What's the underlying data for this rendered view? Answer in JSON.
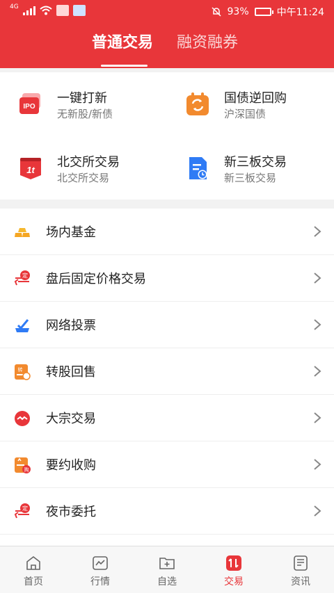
{
  "status_bar": {
    "network": "4G",
    "battery": "93%",
    "time": "中午11:24"
  },
  "tabs": [
    {
      "label": "普通交易",
      "active": true
    },
    {
      "label": "融资融券",
      "active": false
    }
  ],
  "quick_actions": [
    {
      "title": "一键打新",
      "subtitle": "无新股/新债",
      "icon": "ipo-icon",
      "icon_text": "IPO"
    },
    {
      "title": "国债逆回购",
      "subtitle": "沪深国债",
      "icon": "repo-icon"
    },
    {
      "title": "北交所交易",
      "subtitle": "北交所交易",
      "icon": "bse-icon",
      "icon_text": "1t"
    },
    {
      "title": "新三板交易",
      "subtitle": "新三板交易",
      "icon": "neeq-icon"
    }
  ],
  "list_items": [
    {
      "label": "场内基金",
      "icon": "gold-bars-icon"
    },
    {
      "label": "盘后固定价格交易",
      "icon": "fixed-price-icon",
      "icon_text": "定"
    },
    {
      "label": "网络投票",
      "icon": "vote-icon"
    },
    {
      "label": "转股回售",
      "icon": "convert-icon",
      "icon_text": "转"
    },
    {
      "label": "大宗交易",
      "icon": "block-trade-icon"
    },
    {
      "label": "要约收购",
      "icon": "tender-offer-icon",
      "icon_text": "购"
    },
    {
      "label": "夜市委托",
      "icon": "night-order-icon",
      "icon_text": "定"
    }
  ],
  "bottom_nav": [
    {
      "label": "首页",
      "icon": "home-icon",
      "active": false
    },
    {
      "label": "行情",
      "icon": "market-icon",
      "active": false
    },
    {
      "label": "自选",
      "icon": "watchlist-icon",
      "active": false
    },
    {
      "label": "交易",
      "icon": "trade-icon",
      "active": true
    },
    {
      "label": "资讯",
      "icon": "news-icon",
      "active": false
    }
  ],
  "colors": {
    "brand_red": "#e8363a",
    "orange": "#f28a2e",
    "blue": "#2f7bf5"
  }
}
